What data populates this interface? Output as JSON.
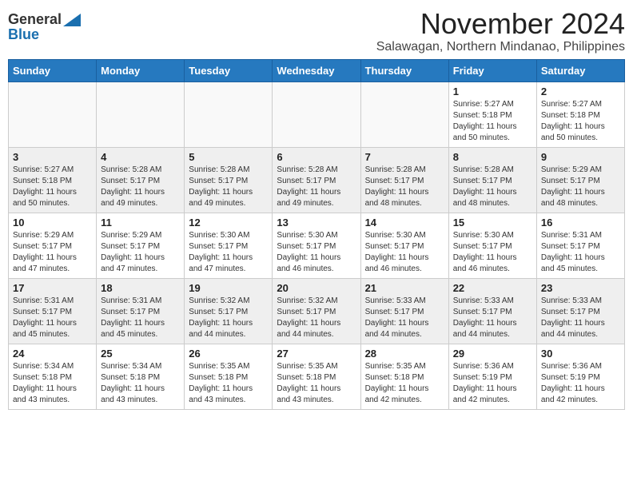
{
  "header": {
    "logo_general": "General",
    "logo_blue": "Blue",
    "month": "November 2024",
    "location": "Salawagan, Northern Mindanao, Philippines"
  },
  "weekdays": [
    "Sunday",
    "Monday",
    "Tuesday",
    "Wednesday",
    "Thursday",
    "Friday",
    "Saturday"
  ],
  "weeks": [
    [
      {
        "day": "",
        "sunrise": "",
        "sunset": "",
        "daylight": ""
      },
      {
        "day": "",
        "sunrise": "",
        "sunset": "",
        "daylight": ""
      },
      {
        "day": "",
        "sunrise": "",
        "sunset": "",
        "daylight": ""
      },
      {
        "day": "",
        "sunrise": "",
        "sunset": "",
        "daylight": ""
      },
      {
        "day": "",
        "sunrise": "",
        "sunset": "",
        "daylight": ""
      },
      {
        "day": "1",
        "sunrise": "Sunrise: 5:27 AM",
        "sunset": "Sunset: 5:18 PM",
        "daylight": "Daylight: 11 hours and 50 minutes."
      },
      {
        "day": "2",
        "sunrise": "Sunrise: 5:27 AM",
        "sunset": "Sunset: 5:18 PM",
        "daylight": "Daylight: 11 hours and 50 minutes."
      }
    ],
    [
      {
        "day": "3",
        "sunrise": "Sunrise: 5:27 AM",
        "sunset": "Sunset: 5:18 PM",
        "daylight": "Daylight: 11 hours and 50 minutes."
      },
      {
        "day": "4",
        "sunrise": "Sunrise: 5:28 AM",
        "sunset": "Sunset: 5:17 PM",
        "daylight": "Daylight: 11 hours and 49 minutes."
      },
      {
        "day": "5",
        "sunrise": "Sunrise: 5:28 AM",
        "sunset": "Sunset: 5:17 PM",
        "daylight": "Daylight: 11 hours and 49 minutes."
      },
      {
        "day": "6",
        "sunrise": "Sunrise: 5:28 AM",
        "sunset": "Sunset: 5:17 PM",
        "daylight": "Daylight: 11 hours and 49 minutes."
      },
      {
        "day": "7",
        "sunrise": "Sunrise: 5:28 AM",
        "sunset": "Sunset: 5:17 PM",
        "daylight": "Daylight: 11 hours and 48 minutes."
      },
      {
        "day": "8",
        "sunrise": "Sunrise: 5:28 AM",
        "sunset": "Sunset: 5:17 PM",
        "daylight": "Daylight: 11 hours and 48 minutes."
      },
      {
        "day": "9",
        "sunrise": "Sunrise: 5:29 AM",
        "sunset": "Sunset: 5:17 PM",
        "daylight": "Daylight: 11 hours and 48 minutes."
      }
    ],
    [
      {
        "day": "10",
        "sunrise": "Sunrise: 5:29 AM",
        "sunset": "Sunset: 5:17 PM",
        "daylight": "Daylight: 11 hours and 47 minutes."
      },
      {
        "day": "11",
        "sunrise": "Sunrise: 5:29 AM",
        "sunset": "Sunset: 5:17 PM",
        "daylight": "Daylight: 11 hours and 47 minutes."
      },
      {
        "day": "12",
        "sunrise": "Sunrise: 5:30 AM",
        "sunset": "Sunset: 5:17 PM",
        "daylight": "Daylight: 11 hours and 47 minutes."
      },
      {
        "day": "13",
        "sunrise": "Sunrise: 5:30 AM",
        "sunset": "Sunset: 5:17 PM",
        "daylight": "Daylight: 11 hours and 46 minutes."
      },
      {
        "day": "14",
        "sunrise": "Sunrise: 5:30 AM",
        "sunset": "Sunset: 5:17 PM",
        "daylight": "Daylight: 11 hours and 46 minutes."
      },
      {
        "day": "15",
        "sunrise": "Sunrise: 5:30 AM",
        "sunset": "Sunset: 5:17 PM",
        "daylight": "Daylight: 11 hours and 46 minutes."
      },
      {
        "day": "16",
        "sunrise": "Sunrise: 5:31 AM",
        "sunset": "Sunset: 5:17 PM",
        "daylight": "Daylight: 11 hours and 45 minutes."
      }
    ],
    [
      {
        "day": "17",
        "sunrise": "Sunrise: 5:31 AM",
        "sunset": "Sunset: 5:17 PM",
        "daylight": "Daylight: 11 hours and 45 minutes."
      },
      {
        "day": "18",
        "sunrise": "Sunrise: 5:31 AM",
        "sunset": "Sunset: 5:17 PM",
        "daylight": "Daylight: 11 hours and 45 minutes."
      },
      {
        "day": "19",
        "sunrise": "Sunrise: 5:32 AM",
        "sunset": "Sunset: 5:17 PM",
        "daylight": "Daylight: 11 hours and 44 minutes."
      },
      {
        "day": "20",
        "sunrise": "Sunrise: 5:32 AM",
        "sunset": "Sunset: 5:17 PM",
        "daylight": "Daylight: 11 hours and 44 minutes."
      },
      {
        "day": "21",
        "sunrise": "Sunrise: 5:33 AM",
        "sunset": "Sunset: 5:17 PM",
        "daylight": "Daylight: 11 hours and 44 minutes."
      },
      {
        "day": "22",
        "sunrise": "Sunrise: 5:33 AM",
        "sunset": "Sunset: 5:17 PM",
        "daylight": "Daylight: 11 hours and 44 minutes."
      },
      {
        "day": "23",
        "sunrise": "Sunrise: 5:33 AM",
        "sunset": "Sunset: 5:17 PM",
        "daylight": "Daylight: 11 hours and 44 minutes."
      }
    ],
    [
      {
        "day": "24",
        "sunrise": "Sunrise: 5:34 AM",
        "sunset": "Sunset: 5:18 PM",
        "daylight": "Daylight: 11 hours and 43 minutes."
      },
      {
        "day": "25",
        "sunrise": "Sunrise: 5:34 AM",
        "sunset": "Sunset: 5:18 PM",
        "daylight": "Daylight: 11 hours and 43 minutes."
      },
      {
        "day": "26",
        "sunrise": "Sunrise: 5:35 AM",
        "sunset": "Sunset: 5:18 PM",
        "daylight": "Daylight: 11 hours and 43 minutes."
      },
      {
        "day": "27",
        "sunrise": "Sunrise: 5:35 AM",
        "sunset": "Sunset: 5:18 PM",
        "daylight": "Daylight: 11 hours and 43 minutes."
      },
      {
        "day": "28",
        "sunrise": "Sunrise: 5:35 AM",
        "sunset": "Sunset: 5:18 PM",
        "daylight": "Daylight: 11 hours and 42 minutes."
      },
      {
        "day": "29",
        "sunrise": "Sunrise: 5:36 AM",
        "sunset": "Sunset: 5:19 PM",
        "daylight": "Daylight: 11 hours and 42 minutes."
      },
      {
        "day": "30",
        "sunrise": "Sunrise: 5:36 AM",
        "sunset": "Sunset: 5:19 PM",
        "daylight": "Daylight: 11 hours and 42 minutes."
      }
    ]
  ]
}
